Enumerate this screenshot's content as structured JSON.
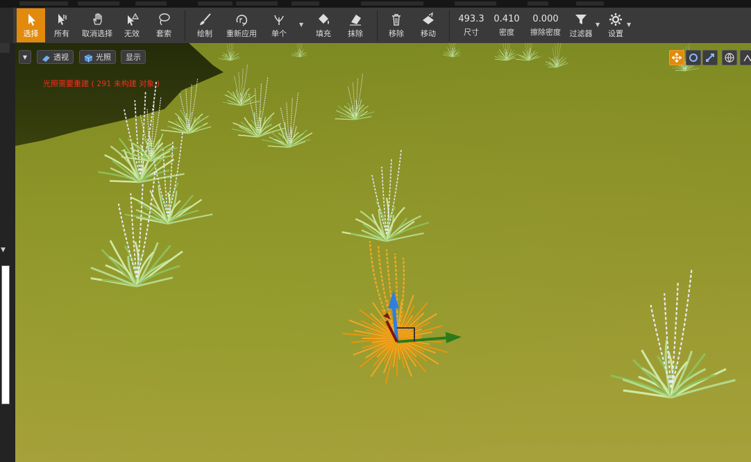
{
  "toolbar": {
    "buttons": [
      {
        "label": "选择",
        "icon": "cursor-icon",
        "active": true
      },
      {
        "label": "所有",
        "icon": "select-all-icon"
      },
      {
        "label": "取消选择",
        "icon": "hand-icon"
      },
      {
        "label": "无效",
        "icon": "invalid-icon"
      },
      {
        "label": "套索",
        "icon": "lasso-icon"
      },
      {
        "label": "绘制",
        "icon": "brush-icon"
      },
      {
        "label": "重新应用",
        "icon": "reapply-icon"
      },
      {
        "label": "单个",
        "icon": "single-plant-icon"
      },
      {
        "label": "填充",
        "icon": "fill-icon"
      },
      {
        "label": "抹除",
        "icon": "eraser-icon"
      },
      {
        "label": "移除",
        "icon": "trash-icon"
      },
      {
        "label": "移动",
        "icon": "move-icon"
      },
      {
        "label": "过滤器",
        "icon": "filter-icon"
      },
      {
        "label": "设置",
        "icon": "gear-icon"
      }
    ],
    "values": [
      {
        "value": "493.3",
        "label": "尺寸"
      },
      {
        "value": "0.410",
        "label": "密度"
      },
      {
        "value": "0.000",
        "label": "擦除密度"
      }
    ],
    "accent": "#e28a0c"
  },
  "viewport": {
    "perspective_label": "透视",
    "lighting_label": "光照",
    "show_label": "显示",
    "warning": "光照需要重建 ( 291 未构建 对象 )",
    "warning_color": "#ff2a1e"
  }
}
